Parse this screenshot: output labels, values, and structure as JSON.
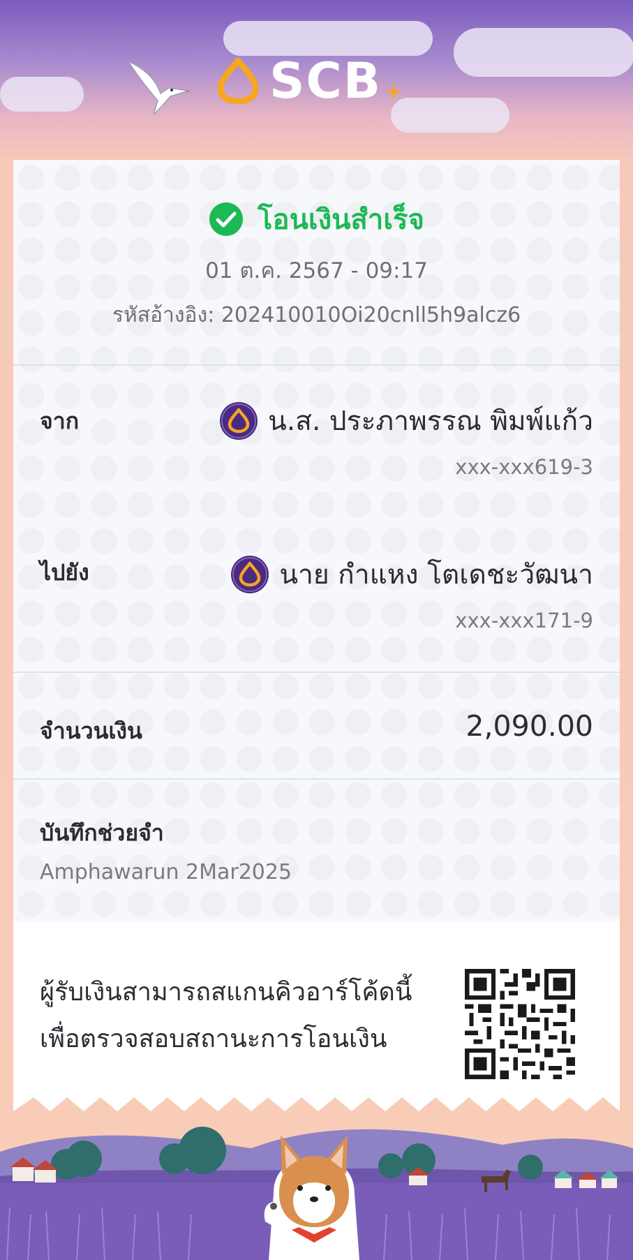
{
  "brand": {
    "name": "SCB",
    "plus": "+"
  },
  "status": {
    "text": "โอนเงินสำเร็จ",
    "color": "#1db954"
  },
  "datetime": "01 ต.ค. 2567 - 09:17",
  "reference": "รหัสอ้างอิง: 202410010Oi20cnll5h9alcz6",
  "from": {
    "label": "จาก",
    "name": "น.ส. ประภาพรรณ พิมพ์แก้ว",
    "account": "xxx-xxx619-3"
  },
  "to": {
    "label": "ไปยัง",
    "name": "นาย กำแหง โตเดชะวัฒนา",
    "account": "xxx-xxx171-9"
  },
  "amount": {
    "label": "จำนวนเงิน",
    "value": "2,090.00"
  },
  "memo": {
    "label": "บันทึกช่วยจำ",
    "value": "Amphawarun 2Mar2025"
  },
  "qr_info": {
    "line1": "ผู้รับเงินสามารถสแกนคิวอาร์โค้ดนี้",
    "line2": "เพื่อตรวจสอบสถานะการโอนเงิน"
  },
  "colors": {
    "accent_purple": "#4b2a83",
    "gold": "#f5a623",
    "success": "#1db954"
  },
  "icons": [
    "scb-logo-icon",
    "check-circle-icon",
    "scb-bank-icon",
    "qr-code-icon",
    "bird-illustration",
    "shiba-illustration"
  ]
}
